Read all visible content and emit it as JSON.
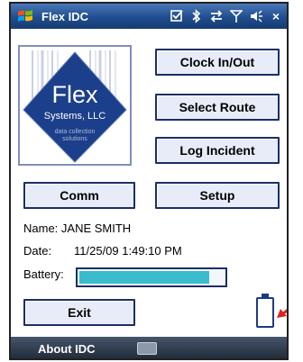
{
  "titlebar": {
    "app_title": "Flex IDC",
    "close_label": "×"
  },
  "logo": {
    "line1": "Flex",
    "line2": "Systems, LLC",
    "line3": "data collection",
    "line4": "solutions"
  },
  "buttons": {
    "clock": "Clock In/Out",
    "route": "Select Route",
    "incident": "Log Incident",
    "comm": "Comm",
    "setup": "Setup",
    "exit": "Exit"
  },
  "info": {
    "name": "Name: JANE SMITH",
    "date_label": "Date:",
    "date_value": "11/25/09 1:49:10 PM",
    "battery_label": "Battery:",
    "battery_level": 0.9
  },
  "bottombar": {
    "about": "About IDC"
  },
  "colors": {
    "titlebar": "#1f4d8e",
    "battery_fill": "#39bccc",
    "logo_blue": "#1b3f8a",
    "arrow": "#e02020"
  },
  "icons": [
    "windows-start-icon",
    "checkbox-icon",
    "bluetooth-icon",
    "sync-icon",
    "signal-icon",
    "volume-icon",
    "close-icon",
    "battery-icon",
    "keyboard-icon"
  ]
}
